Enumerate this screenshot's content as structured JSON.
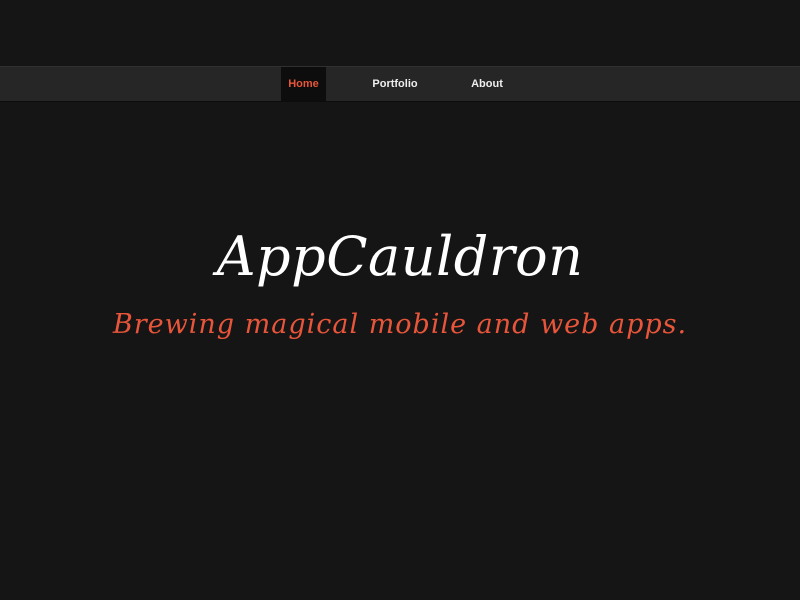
{
  "nav": {
    "items": [
      {
        "label": "Home",
        "active": true
      },
      {
        "label": "Portfolio",
        "active": false
      },
      {
        "label": "About",
        "active": false
      }
    ]
  },
  "hero": {
    "title": "AppCauldron",
    "tagline": "Brewing magical mobile and web apps."
  },
  "colors": {
    "background": "#151515",
    "navbar": "#262626",
    "active_tab": "#0d0d0d",
    "accent": "#e8553a",
    "text": "#ffffff"
  }
}
